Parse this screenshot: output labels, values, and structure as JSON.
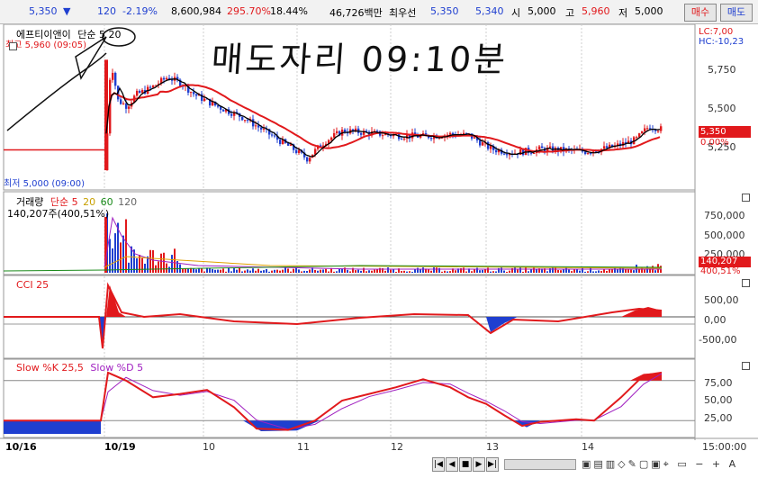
{
  "topbar": {
    "price": "5,350",
    "change_arrow": "▼",
    "change": "120",
    "change_pct": "-2.19%",
    "volume": "8,600,984",
    "vol_ratio": "295.70%",
    "turnover": "18.44%",
    "amount": "46,726백만",
    "ask_label": "최우선",
    "ask": "5,350",
    "bid": "5,340",
    "open_label": "시",
    "open": "5,000",
    "high_label": "고",
    "high": "5,960",
    "low_label": "저",
    "low": "5,000",
    "buy_label": "매수",
    "sell_label": "매도"
  },
  "price_panel": {
    "legend_name": "에프티이앤이",
    "legend_ma": "단순 5  20",
    "high_label": "최고 5,960 (09:05)",
    "low_label": "최저 5,000 (09:00)",
    "lc_label": "LC:7,00",
    "hc_label": "HC:-10,23",
    "current_price": "5,350",
    "current_pct": "0.00%",
    "yaxis": [
      "5,750",
      "5,500",
      "5,250"
    ]
  },
  "volume_panel": {
    "legend_title": "거래량",
    "legend_ma": "단순 5",
    "legend_ma2": "20",
    "legend_ma3": "60",
    "legend_ma4": "120",
    "legend_value": "140,207주(400,51%)",
    "yaxis": [
      "750,000",
      "500,000",
      "250,000"
    ],
    "current_value": "140,207",
    "current_pct": "400,51%"
  },
  "cci_panel": {
    "legend": "CCI 25",
    "yaxis": [
      "500,00",
      "0,00",
      "-500,00"
    ]
  },
  "stoch_panel": {
    "legend_k": "Slow %K 25,5",
    "legend_d": "Slow %D 5",
    "yaxis": [
      "75,00",
      "50,00",
      "25,00"
    ]
  },
  "xaxis": {
    "labels": [
      "10/16",
      "10/19",
      "10",
      "11",
      "12",
      "13",
      "14"
    ],
    "time": "15:00:00"
  },
  "annotation": {
    "handwriting": "매도자리 09:10분"
  },
  "scrollbar": {
    "controls": [
      "|◀",
      "◀",
      "■",
      "▶",
      "▶|"
    ]
  },
  "chart_data": {
    "type": "candlestick",
    "colors": {
      "up": "#e1191c",
      "down": "#1f3fd0",
      "ma5": "#000000",
      "ma20": "#e1191c",
      "cci": "#e1191c",
      "stochK": "#e1191c",
      "stochD": "#a020c0"
    },
    "price_ylim": [
      4850,
      6150
    ],
    "cci_ylim": [
      -800,
      800
    ],
    "stoch_ylim": [
      0,
      100
    ]
  }
}
